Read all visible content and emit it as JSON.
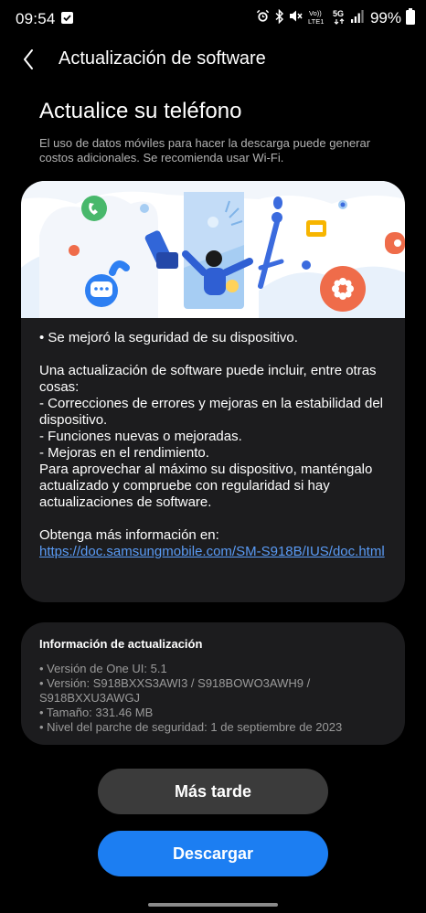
{
  "status_bar": {
    "time": "09:54",
    "battery_percent": "99%",
    "icons": [
      "notification-check-icon",
      "alarm-icon",
      "bluetooth-icon",
      "mute-icon",
      "volte-icon",
      "5g-icon",
      "signal-icon",
      "battery-icon"
    ],
    "volte_label": "Vo)) LTE1",
    "network_label": "5G"
  },
  "app_bar": {
    "title": "Actualización de software",
    "back_icon": "chevron-left-icon"
  },
  "main": {
    "heading": "Actualice su teléfono",
    "data_warning": "El uso de datos móviles para hacer la descarga puede generar costos adicionales. Se recomienda usar Wi-Fi."
  },
  "update_card": {
    "illustration_icon": "software-update-illustration",
    "security_note": "• Se mejoró la seguridad de su dispositivo.",
    "intro": "Una actualización de software puede incluir, entre otras cosas:",
    "items": [
      " - Correcciones de errores y mejoras en la estabilidad del dispositivo.",
      " - Funciones nuevas o mejoradas.",
      " - Mejoras en el rendimiento."
    ],
    "advice": "Para aprovechar al máximo su dispositivo, manténgalo actualizado y compruebe con regularidad si hay actualizaciones de software.",
    "more_info_label": "Obtenga más información en:",
    "more_info_link": "https://doc.samsungmobile.com/SM-S918B/IUS/doc.html"
  },
  "info_card": {
    "title": "Información de actualización",
    "lines": [
      "• Versión de One UI: 5.1",
      "• Versión: S918BXXS3AWI3 / S918BOWO3AWH9 / S918BXXU3AWGJ",
      "• Tamaño: 331.46 MB",
      "• Nivel del parche de seguridad: 1 de septiembre de 2023"
    ]
  },
  "buttons": {
    "later": "Más tarde",
    "download": "Descargar"
  },
  "colors": {
    "background": "#000000",
    "card": "#1c1c1e",
    "link": "#5a9bf5",
    "primary_button": "#1c7ef2",
    "secondary_button": "#3b3b3b"
  }
}
